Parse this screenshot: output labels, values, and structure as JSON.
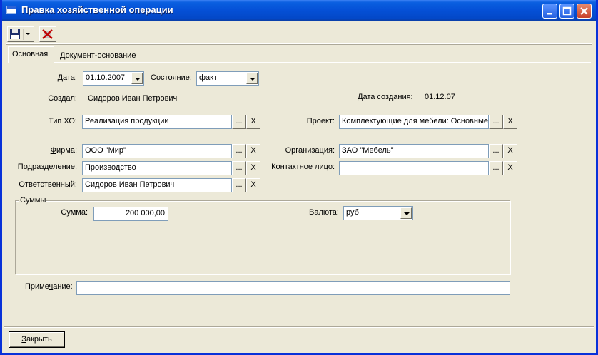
{
  "window": {
    "title": "Правка хозяйственной операции"
  },
  "tabs": [
    {
      "label": "Основная"
    },
    {
      "label": "Документ-основание"
    }
  ],
  "form": {
    "date": {
      "label": "Дата:",
      "value": "01.10.2007"
    },
    "state": {
      "label": "Состояние:",
      "value": "факт"
    },
    "created_by": {
      "label": "Создал:",
      "value": "Сидоров Иван Петрович"
    },
    "created_date": {
      "label": "Дата создания:",
      "value": "01.12.07"
    },
    "op_type": {
      "label": "Тип ХО:",
      "value": "Реализация продукции"
    },
    "project": {
      "label": "Проект:",
      "value": "Комплектующие для мебели: Основные"
    },
    "firm": {
      "label_pre": "",
      "label_u": "Ф",
      "label_post": "ирма:",
      "value": "ООО \"Мир\""
    },
    "organization": {
      "label": "Организация:",
      "value": "ЗАО \"Мебель\""
    },
    "department": {
      "label": "Подразделение:",
      "value": "Производство"
    },
    "contact": {
      "label": "Контактное лицо:",
      "value": ""
    },
    "responsible": {
      "label": "Ответственный:",
      "value": "Сидоров Иван Петрович"
    },
    "sums": {
      "group_label": "Суммы",
      "sum_label": "Сумма:",
      "sum_value": "200 000,00",
      "currency_label": "Валюта:",
      "currency_value": "руб"
    },
    "note": {
      "label_pre": "Приме",
      "label_u": "ч",
      "label_post": "ание:",
      "value": ""
    }
  },
  "buttons": {
    "ellipsis": "...",
    "clear": "X",
    "close_pre": "",
    "close_u": "З",
    "close_post": "акрыть"
  }
}
